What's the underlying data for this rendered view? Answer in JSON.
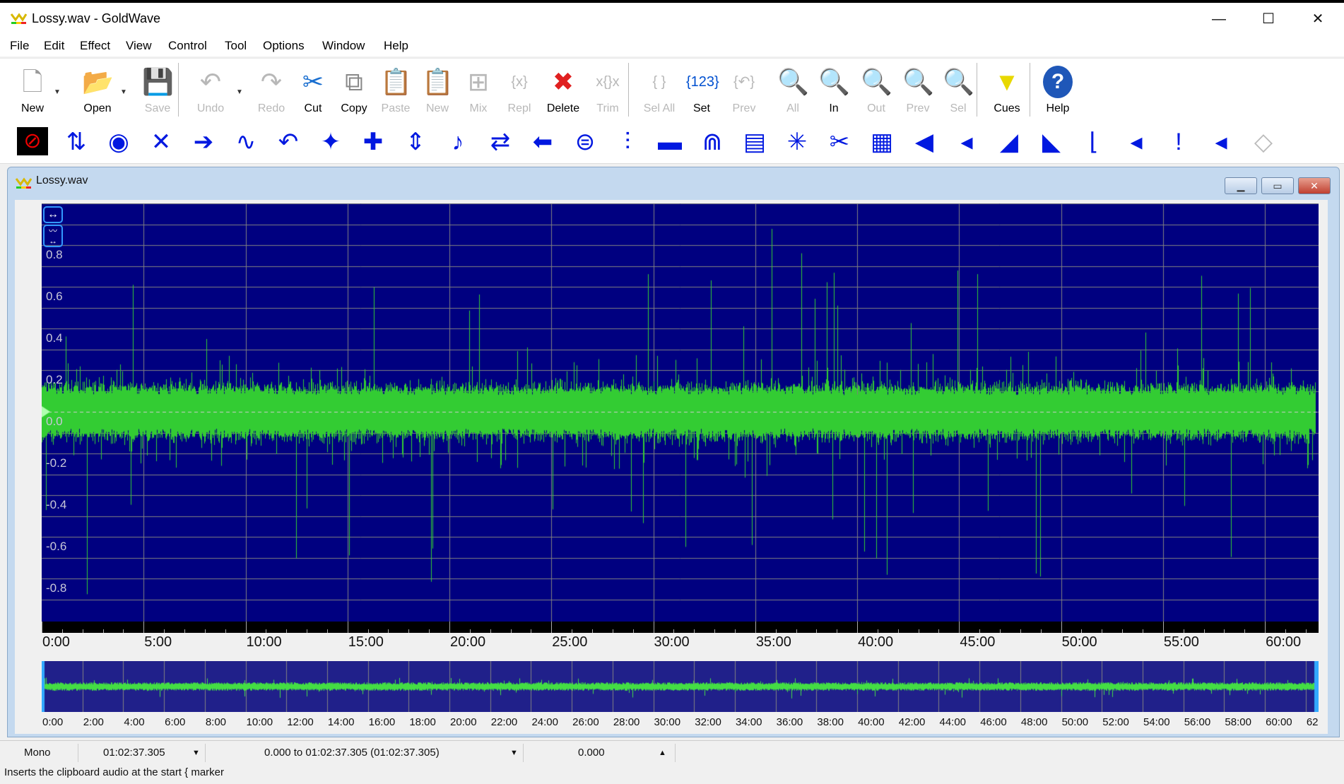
{
  "window": {
    "title": "Lossy.wav - GoldWave",
    "controls": [
      "minimize",
      "maximize",
      "close"
    ]
  },
  "menu": [
    "File",
    "Edit",
    "Effect",
    "View",
    "Control",
    "Tool",
    "Options",
    "Window",
    "Help"
  ],
  "toolbar": [
    {
      "label": "New",
      "icon": "new-file-icon",
      "enabled": true,
      "glyph": "🗋"
    },
    {
      "label": "Open",
      "icon": "open-folder-icon",
      "enabled": true,
      "glyph": "📂"
    },
    {
      "label": "Save",
      "icon": "save-disk-icon",
      "enabled": false,
      "glyph": "💾"
    },
    {
      "label": "Undo",
      "icon": "undo-icon",
      "enabled": false,
      "glyph": "↶"
    },
    {
      "label": "Redo",
      "icon": "redo-icon",
      "enabled": false,
      "glyph": "↷"
    },
    {
      "label": "Cut",
      "icon": "scissors-icon",
      "enabled": true,
      "glyph": "✂"
    },
    {
      "label": "Copy",
      "icon": "copy-icon",
      "enabled": true,
      "glyph": "⧉"
    },
    {
      "label": "Paste",
      "icon": "paste-icon",
      "enabled": false,
      "glyph": "📋"
    },
    {
      "label": "New",
      "icon": "paste-new-icon",
      "enabled": false,
      "glyph": "📋"
    },
    {
      "label": "Mix",
      "icon": "mix-icon",
      "enabled": false,
      "glyph": "⊞"
    },
    {
      "label": "Repl",
      "icon": "replace-icon",
      "enabled": false,
      "glyph": "{x}"
    },
    {
      "label": "Delete",
      "icon": "delete-x-icon",
      "enabled": true,
      "glyph": "✖"
    },
    {
      "label": "Trim",
      "icon": "trim-icon",
      "enabled": false,
      "glyph": "x{}x"
    },
    {
      "label": "Sel All",
      "icon": "select-all-icon",
      "enabled": false,
      "glyph": "{ }"
    },
    {
      "label": "Set",
      "icon": "set-selection-icon",
      "enabled": true,
      "glyph": "{123}"
    },
    {
      "label": "Prev",
      "icon": "previous-selection-icon",
      "enabled": false,
      "glyph": "{↶}"
    },
    {
      "label": "All",
      "icon": "zoom-all-icon",
      "enabled": false,
      "glyph": "🔍"
    },
    {
      "label": "In",
      "icon": "zoom-in-icon",
      "enabled": true,
      "glyph": "🔍"
    },
    {
      "label": "Out",
      "icon": "zoom-out-icon",
      "enabled": false,
      "glyph": "🔍"
    },
    {
      "label": "Prev",
      "icon": "zoom-previous-icon",
      "enabled": false,
      "glyph": "🔍"
    },
    {
      "label": "Sel",
      "icon": "zoom-selection-icon",
      "enabled": false,
      "glyph": "🔍"
    },
    {
      "label": "Cues",
      "icon": "cues-triangle-icon",
      "enabled": true,
      "glyph": "▼"
    },
    {
      "label": "Help",
      "icon": "help-question-icon",
      "enabled": true,
      "glyph": "?"
    }
  ],
  "effects_toolbar": [
    "stop-icon",
    "swap-channels-icon",
    "doppler-icon",
    "mechanize-icon",
    "auto-gain-icon",
    "flanger-icon",
    "reverse-icon",
    "noise-reduction-icon",
    "pitch-icon",
    "compressor-icon",
    "pitch-note-icon",
    "playback-rate-icon",
    "offset-icon",
    "invert-icon",
    "equalizer-icon",
    "filter-icon",
    "spectrum-filter-icon",
    "pop-click-icon",
    "clip-icon",
    "noise-icon",
    "spectrum-icon",
    "volume-icon",
    "volume-change-icon",
    "fade-in-icon",
    "fade-out-icon",
    "shape-volume-icon",
    "match-volume-icon",
    "maximize-volume-icon",
    "volume-shape-icon",
    "disabled-effect-icon"
  ],
  "document": {
    "title": "Lossy.wav",
    "y_labels": [
      "0.8",
      "0.6",
      "0.4",
      "0.2",
      "0.0",
      "-0.2",
      "-0.4",
      "-0.6",
      "-0.8"
    ],
    "time_labels": [
      "0:00",
      "5:00",
      "10:00",
      "15:00",
      "20:00",
      "25:00",
      "30:00",
      "35:00",
      "40:00",
      "45:00",
      "50:00",
      "55:00",
      "60:00"
    ],
    "overview_labels": [
      "0:00",
      "2:00",
      "4:00",
      "6:00",
      "8:00",
      "10:00",
      "12:00",
      "14:00",
      "16:00",
      "18:00",
      "20:00",
      "22:00",
      "24:00",
      "26:00",
      "28:00",
      "30:00",
      "32:00",
      "34:00",
      "36:00",
      "38:00",
      "40:00",
      "42:00",
      "44:00",
      "46:00",
      "48:00",
      "50:00",
      "52:00",
      "54:00",
      "56:00",
      "58:00",
      "60:00",
      "62"
    ],
    "colors": {
      "background": "#000080",
      "waveform": "#33cc33",
      "grid": "#808080"
    }
  },
  "status": {
    "channels": "Mono",
    "length": "01:02:37.305",
    "selection": "0.000 to 01:02:37.305 (01:02:37.305)",
    "position": "0.000",
    "hint": "Inserts the clipboard audio at the start { marker"
  }
}
